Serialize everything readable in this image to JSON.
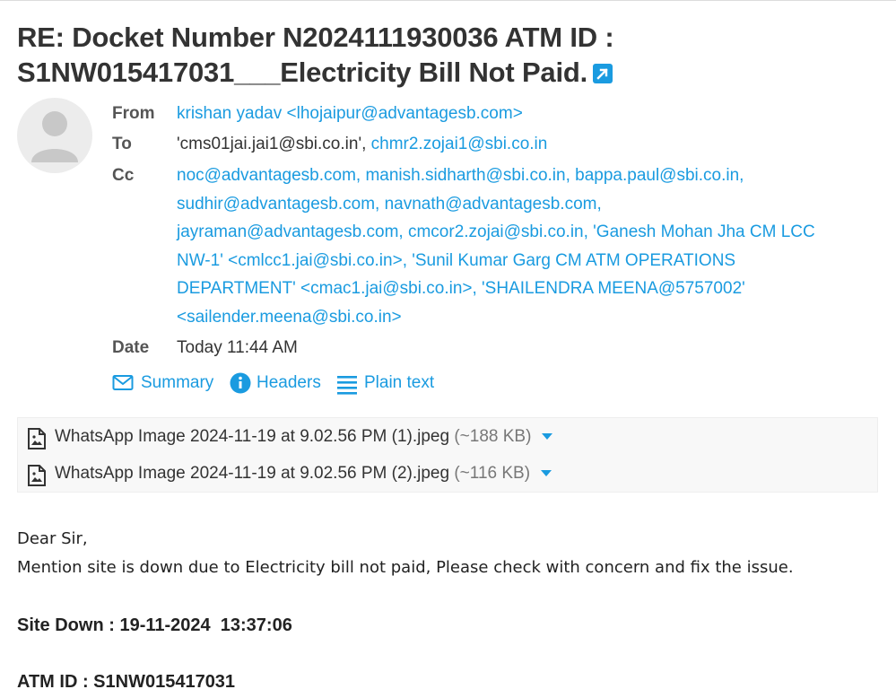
{
  "subject": {
    "line1": "RE: Docket Number N2024111930036 ATM ID :",
    "line2": "S1NW015417031___Electricity Bill Not Paid."
  },
  "headers": {
    "from_label": "From",
    "from_value": "krishan yadav <lhojaipur@advantagesb.com>",
    "to_label": "To",
    "to_plain": "'cms01jai.jai1@sbi.co.in', ",
    "to_link": "chmr2.zojai1@sbi.co.in",
    "cc_label": "Cc",
    "cc_lines": [
      "noc@advantagesb.com, manish.sidharth@sbi.co.in, bappa.paul@sbi.co.in,",
      "sudhir@advantagesb.com, navnath@advantagesb.com,",
      "jayraman@advantagesb.com, cmcor2.zojai@sbi.co.in, 'Ganesh Mohan Jha CM LCC",
      "NW-1' <cmlcc1.jai@sbi.co.in>, 'Sunil Kumar Garg CM ATM OPERATIONS",
      "DEPARTMENT' <cmac1.jai@sbi.co.in>, 'SHAILENDRA MEENA@5757002'",
      "<sailender.meena@sbi.co.in>"
    ],
    "date_label": "Date",
    "date_value": "Today 11:44 AM"
  },
  "actions": {
    "summary": "Summary",
    "headers": "Headers",
    "plain_text": "Plain text"
  },
  "attachments": [
    {
      "name": "WhatsApp Image 2024-11-19 at 9.02.56 PM (1).jpeg",
      "size": "(~188 KB)"
    },
    {
      "name": "WhatsApp Image 2024-11-19 at 9.02.56 PM (2).jpeg",
      "size": "(~116 KB)"
    }
  ],
  "body": {
    "greeting": "Dear Sir,",
    "message": "Mention site is down due to Electricity bill not paid, Please check with concern and fix the issue.",
    "site_down": "Site Down : 19-11-2024  13:37:06",
    "atm_id": "ATM ID : S1NW015417031"
  },
  "colors": {
    "link": "#1a9be0",
    "label": "#555555",
    "attachment_bg": "#f8f8f8"
  },
  "icons": {
    "external": "external-link-icon",
    "avatar": "user-avatar-icon",
    "summary": "envelope-icon",
    "headers": "info-icon",
    "plain_text": "lines-icon",
    "attachment": "image-file-icon",
    "dropdown": "caret-down-icon"
  }
}
